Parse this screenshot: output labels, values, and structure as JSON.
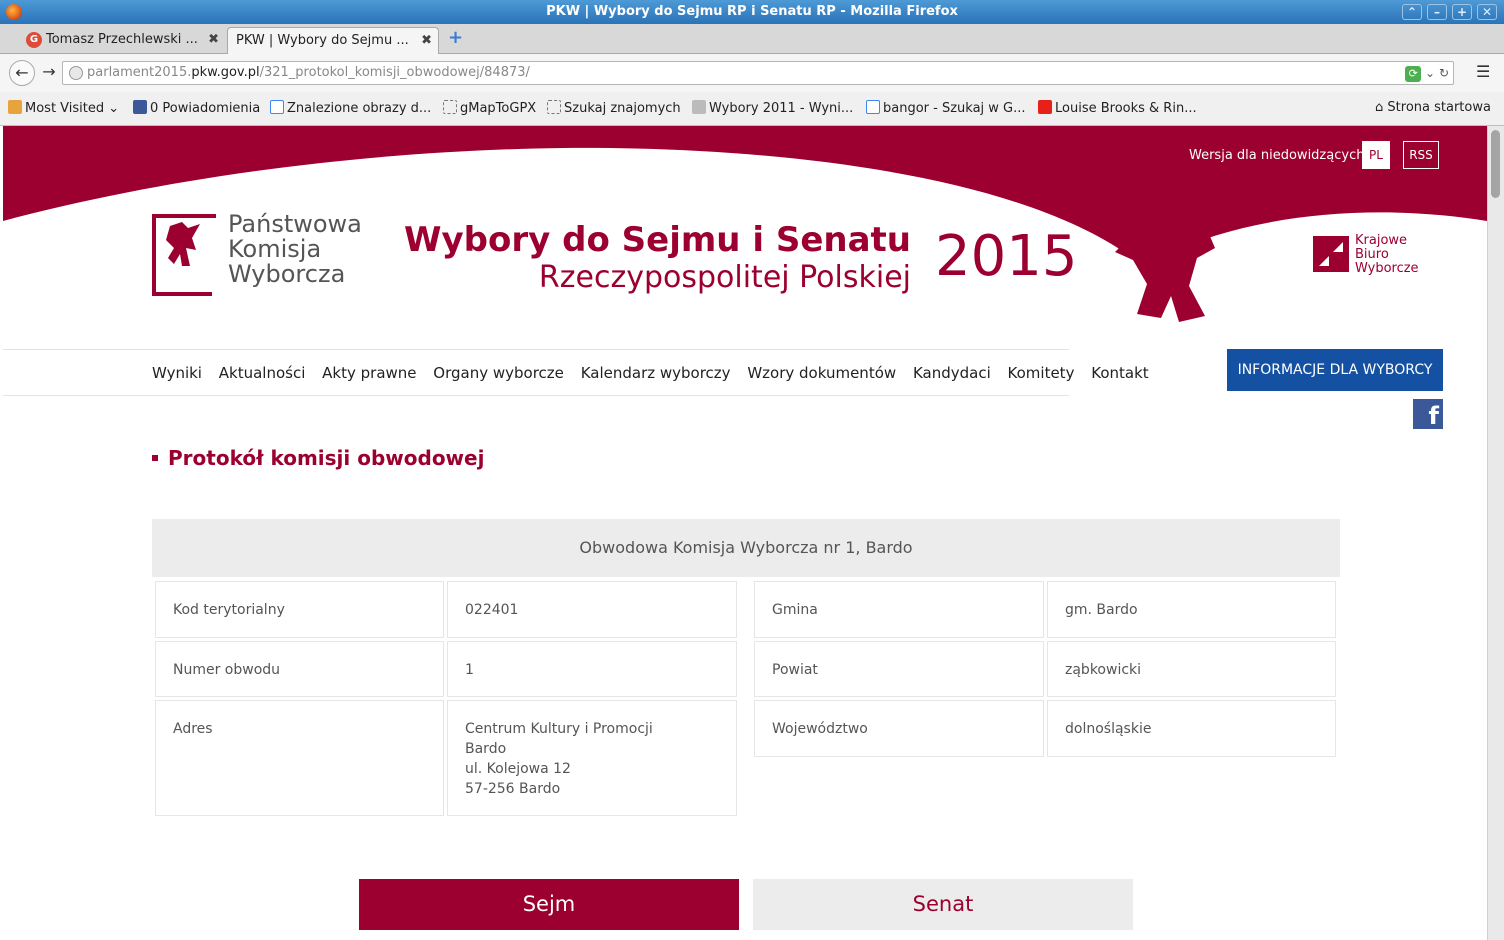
{
  "window": {
    "title": "PKW | Wybory do Sejmu RP i Senatu RP - Mozilla Firefox"
  },
  "tabs": [
    {
      "label": "Tomasz Przechlewski ...",
      "active": false
    },
    {
      "label": "PKW | Wybory do Sejmu ...",
      "active": true
    }
  ],
  "address": {
    "domain_prefix": "parlament2015.",
    "domain": "pkw.gov.pl",
    "path": "/321_protokol_komisji_obwodowej/84873/"
  },
  "bookmarks": [
    {
      "label": "Most Visited",
      "icon": "folder-icon"
    },
    {
      "label": "0 Powiadomienia",
      "icon": "facebook-icon"
    },
    {
      "label": "Znalezione obrazy d...",
      "icon": "google-icon"
    },
    {
      "label": "gMapToGPX",
      "icon": "bookmark-icon"
    },
    {
      "label": "Szukaj znajomych",
      "icon": "bookmark-icon"
    },
    {
      "label": "Wybory 2011 - Wyni...",
      "icon": "pkw-icon"
    },
    {
      "label": "bangor - Szukaj w G...",
      "icon": "google-icon"
    },
    {
      "label": "Louise Brooks & Rin...",
      "icon": "youtube-icon"
    },
    {
      "label": "Strona startowa",
      "icon": "home-icon"
    }
  ],
  "header": {
    "access_link": "Wersja dla niedowidzących",
    "lang": "PL",
    "rss": "RSS",
    "logo_lines": [
      "Państwowa",
      "Komisja",
      "Wyborcza"
    ],
    "title_line1": "Wybory do Sejmu i Senatu",
    "title_line2": "Rzeczypospolitej Polskiej",
    "year": "2015",
    "kbw_lines": [
      "Krajowe",
      "Biuro",
      "Wyborcze"
    ]
  },
  "nav": [
    "Wyniki",
    "Aktualności",
    "Akty prawne",
    "Organy wyborcze",
    "Kalendarz wyborczy",
    "Wzory dokumentów",
    "Kandydaci",
    "Komitety",
    "Kontakt"
  ],
  "info_button": "INFORMACJE DLA WYBORCY",
  "section_title": "Protokół komisji obwodowej",
  "commission": "Obwodowa Komisja Wyborcza nr 1, Bardo",
  "details_left": [
    {
      "label": "Kod terytorialny",
      "value": "022401"
    },
    {
      "label": "Numer obwodu",
      "value": "1"
    },
    {
      "label": "Adres",
      "value_lines": [
        "Centrum Kultury i Promocji",
        "Bardo",
        "ul. Kolejowa 12",
        "57-256 Bardo"
      ]
    }
  ],
  "details_right": [
    {
      "label": "Gmina",
      "value": "gm. Bardo"
    },
    {
      "label": "Powiat",
      "value": "ząbkowicki"
    },
    {
      "label": "Województwo",
      "value": "dolnośląskie"
    }
  ],
  "buttons": {
    "sejm": "Sejm",
    "senat": "Senat"
  },
  "colors": {
    "brand": "#9b0030",
    "info_blue": "#1551a3",
    "grey_bg": "#ececec"
  }
}
